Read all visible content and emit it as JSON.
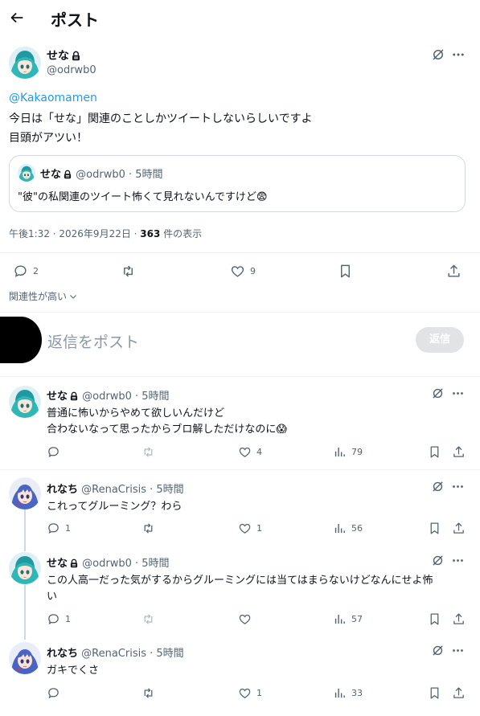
{
  "header": {
    "title": "ポスト"
  },
  "main_post": {
    "author_name": "せな",
    "author_handle": "@odrwb0",
    "mention": "@Kakaomamen",
    "line1": "今日は「せな」関連のことしかツイートしないらしいですよ",
    "line2": "目頭がアツい！",
    "quote": {
      "author_name": "せな",
      "author_handle": "@odrwb0",
      "time": "5時間",
      "text": "\"彼\"の私関連のツイート怖くて見れないんですけど😨"
    },
    "timestamp": "午後1:32 · 2026年9月22日 · ",
    "views_count": "363",
    "views_label": " 件の表示",
    "reply_count": "2",
    "like_count": "9"
  },
  "sort": {
    "label": "関連性が高い"
  },
  "compose": {
    "placeholder": "返信をポスト",
    "button": "返信"
  },
  "replies": [
    {
      "author_name": "せな",
      "handle_time": "@odrwb0 · 5時間",
      "line1": "普通に怖いからやめて欲しいんだけど",
      "line2": "合わないなって思ったからブロ解しただけなのに😱",
      "reply_count": "",
      "like_count": "4",
      "view_count": "79"
    },
    {
      "author_name": "れなち",
      "handle_time": "@RenaCrisis · 5時間",
      "line1": "これってグルーミング？わら",
      "line2": "",
      "reply_count": "1",
      "like_count": "1",
      "view_count": "56"
    },
    {
      "author_name": "せな",
      "handle_time": "@odrwb0 · 5時間",
      "line1": "この人高一だった気がするからグルーミングには当てはまらないけどなんにせよ怖",
      "line2": "い",
      "reply_count": "1",
      "like_count": "",
      "view_count": "57"
    },
    {
      "author_name": "れなち",
      "handle_time": "@RenaCrisis · 5時間",
      "line1": "ガキでくさ",
      "line2": "",
      "reply_count": "",
      "like_count": "1",
      "view_count": "33"
    }
  ],
  "colors": {
    "link": "#1d9bf0",
    "muted": "#536471",
    "border": "#eff3f4",
    "disabled_button": "#e1e3e5"
  }
}
